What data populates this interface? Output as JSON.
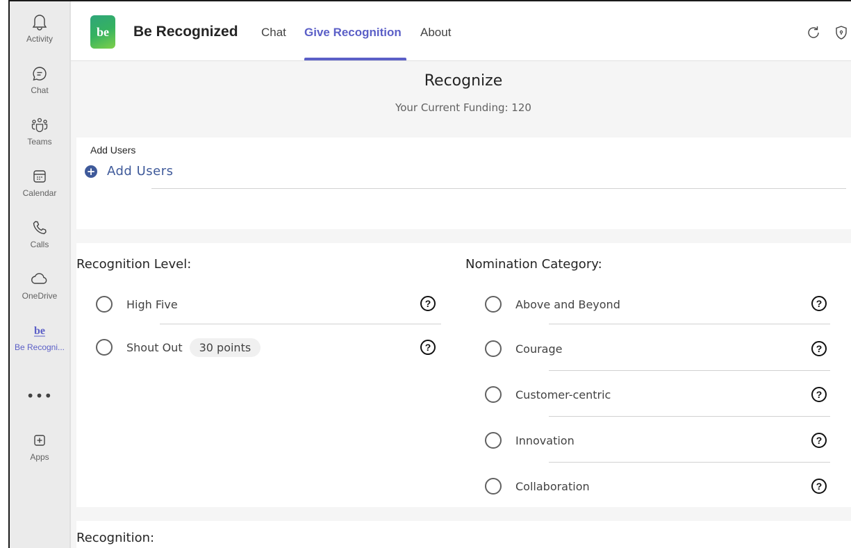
{
  "rail": {
    "items": [
      {
        "label": "Activity",
        "icon": "bell-icon"
      },
      {
        "label": "Chat",
        "icon": "chat-icon"
      },
      {
        "label": "Teams",
        "icon": "teams-icon"
      },
      {
        "label": "Calendar",
        "icon": "calendar-icon"
      },
      {
        "label": "Calls",
        "icon": "phone-icon"
      },
      {
        "label": "OneDrive",
        "icon": "cloud-icon"
      },
      {
        "label": "Be Recogni...",
        "icon": "be-recognized-logo-icon"
      },
      {
        "label": "Apps",
        "icon": "add-apps-icon"
      }
    ],
    "more": "•••",
    "active_color": "#5b5fc7"
  },
  "header": {
    "logo_text": "be",
    "app_name": "Be Recognized",
    "tabs": [
      {
        "label": "Chat"
      },
      {
        "label": "Give Recognition",
        "active": true
      },
      {
        "label": "About"
      }
    ]
  },
  "page": {
    "title": "Recognize",
    "funding": "Your Current Funding: 120"
  },
  "users": {
    "label": "Add Users",
    "add_button": "Add Users"
  },
  "recognition_level": {
    "heading": "Recognition Level:",
    "options": [
      {
        "label": "High Five",
        "points": ""
      },
      {
        "label": "Shout Out",
        "points": "30 points"
      }
    ]
  },
  "nomination_category": {
    "heading": "Nomination Category:",
    "options": [
      {
        "label": "Above and Beyond"
      },
      {
        "label": "Courage"
      },
      {
        "label": "Customer-centric"
      },
      {
        "label": "Innovation"
      },
      {
        "label": "Collaboration"
      }
    ]
  },
  "recognition": {
    "heading": "Recognition:"
  },
  "help_glyph": "?",
  "colors": {
    "accent": "#5b5fc7",
    "link": "#3f5a9a"
  }
}
